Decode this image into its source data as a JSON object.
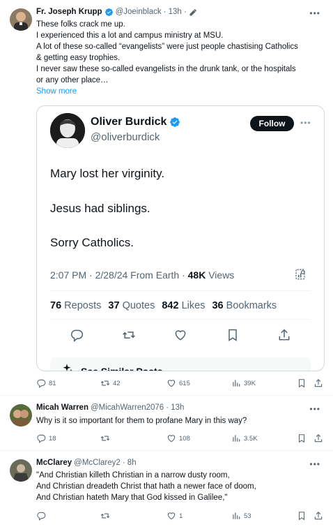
{
  "main_tweet": {
    "name": "Fr. Joseph Krupp",
    "handle": "@Joeinblack",
    "time": "· 13h ·",
    "lines": [
      "These folks crack me up.",
      "I experienced this a lot and campus ministry at MSU.",
      "A lot of these so-called “evangelists” were just people chastising Catholics",
      "& getting easy trophies.",
      "I never saw these so-called evangelists in the drunk tank, or the hospitals",
      "or any other place…"
    ],
    "show_more": "Show more",
    "replies": "81",
    "retweets": "42",
    "likes": "615",
    "views": "39K"
  },
  "quoted_tweet": {
    "name": "Oliver Burdick",
    "handle": "@oliverburdick",
    "follow_label": "Follow",
    "text_lines": [
      "Mary lost her virginity.",
      "Jesus had siblings.",
      "Sorry Catholics."
    ],
    "time_prefix": "2:07 PM · 2/28/24 From Earth ·",
    "views_count": "48K",
    "views_label": "Views",
    "reposts_count": "76",
    "reposts_label": "Reposts",
    "quotes_count": "37",
    "quotes_label": "Quotes",
    "likes_count": "842",
    "likes_label": "Likes",
    "bookmarks_count": "36",
    "bookmarks_label": "Bookmarks",
    "similar_label": "See Similar Posts"
  },
  "reply_1": {
    "name": "Micah Warren",
    "handle": "@MicahWarren2076",
    "time": "· 13h",
    "text": "Why is it so important for them to profane Mary in this way?",
    "replies": "18",
    "retweets": "",
    "likes": "108",
    "views": "3.5K"
  },
  "reply_2": {
    "name": "McClarey",
    "handle": "@McClarey2",
    "time": "· 8h",
    "lines": [
      "\"And Christian killeth Christian in a narrow dusty room,",
      "And Christian dreadeth Christ that hath a newer face of doom,",
      "And Christian hateth Mary that God kissed in Galilee,\""
    ],
    "replies": "",
    "retweets": "",
    "likes": "1",
    "views": "53"
  },
  "colors": {
    "accent": "#1d9bf0",
    "text": "#0f1419",
    "muted": "#536471",
    "border": "#cfd9de"
  },
  "icons": [
    "reply-icon",
    "retweet-icon",
    "like-icon",
    "views-icon",
    "bookmark-icon",
    "share-icon",
    "verified-icon",
    "edit-icon",
    "more-icon"
  ]
}
